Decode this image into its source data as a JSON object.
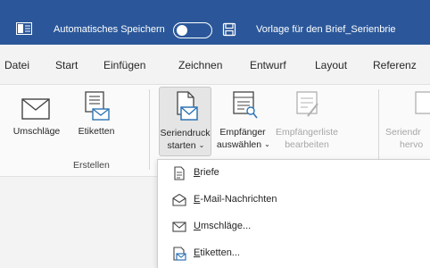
{
  "titlebar": {
    "app_icon": "word-document-icon",
    "autosave_label": "Automatisches Speichern",
    "autosave_state": "off",
    "save_icon": "save-icon",
    "document_title": "Vorlage für den Brief_Serienbrie"
  },
  "menu": {
    "tabs": [
      "Datei",
      "Start",
      "Einfügen",
      "Zeichnen",
      "Entwurf",
      "Layout",
      "Referenz"
    ]
  },
  "ribbon": {
    "envelopes": "Umschläge",
    "labels": "Etiketten",
    "create_group": "Erstellen",
    "mail_merge_line1": "Seriendruck",
    "mail_merge_line2": "starten",
    "recipients_line1": "Empfänger",
    "recipients_line2": "auswählen",
    "edit_list_line1": "Empfängerliste",
    "edit_list_line2": "bearbeiten",
    "highlight_line1": "Seriendr",
    "highlight_line2": "hervo"
  },
  "dropdown": {
    "items": [
      {
        "first": "B",
        "rest": "riefe",
        "icon": "document-icon"
      },
      {
        "first": "E",
        "rest": "-Mail-Nachrichten",
        "icon": "open-envelope-icon"
      },
      {
        "first": "U",
        "rest": "mschläge...",
        "icon": "envelope-icon"
      },
      {
        "first": "E",
        "rest": "tiketten...",
        "icon": "label-icon"
      }
    ]
  },
  "colors": {
    "titlebar": "#2b579a",
    "accent_blue": "#2e74b5"
  }
}
